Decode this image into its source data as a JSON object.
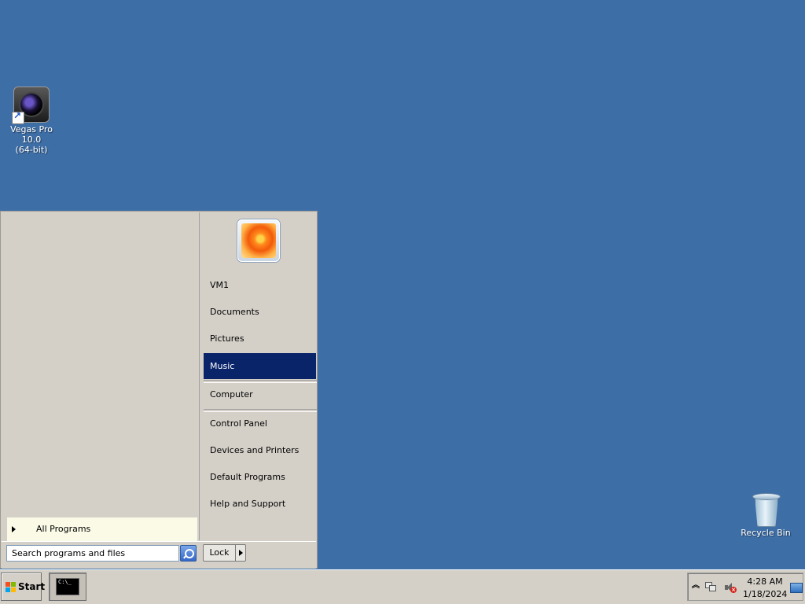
{
  "colors": {
    "desktop": "#3e6ea6",
    "selection": "#0a246a",
    "panel": "#d4d0c8",
    "all_programs_bg": "#fafae6"
  },
  "desktop": {
    "icons": [
      {
        "name": "vegas-pro-shortcut",
        "label_line1": "Vegas Pro 10.0",
        "label_line2": "(64-bit)",
        "icon": "vegas-camera-icon"
      },
      {
        "name": "recycle-bin",
        "label_line1": "Recycle Bin",
        "icon": "recycle-bin-icon"
      }
    ]
  },
  "start_menu": {
    "user_picture": "flower-user-icon",
    "right_items": [
      {
        "label": "VM1"
      },
      {
        "label": "Documents"
      },
      {
        "label": "Pictures"
      },
      {
        "label": "Music",
        "selected": true
      },
      {
        "label": "Computer"
      },
      {
        "label": "Control Panel"
      },
      {
        "label": "Devices and Printers"
      },
      {
        "label": "Default Programs"
      },
      {
        "label": "Help and Support"
      }
    ],
    "all_programs_label": "All Programs",
    "search_placeholder": "Search programs and files",
    "search_value": "",
    "lock_label": "Lock"
  },
  "taskbar": {
    "start_label": "Start",
    "pinned": [
      {
        "name": "command-prompt",
        "icon": "cmd-icon",
        "screen_text": "C:\\_"
      }
    ],
    "tray": {
      "time": "4:28 AM",
      "date": "1/18/2024",
      "icons": [
        "tray-chevron-icon",
        "network-icon",
        "volume-muted-icon",
        "show-desktop-icon"
      ]
    }
  }
}
